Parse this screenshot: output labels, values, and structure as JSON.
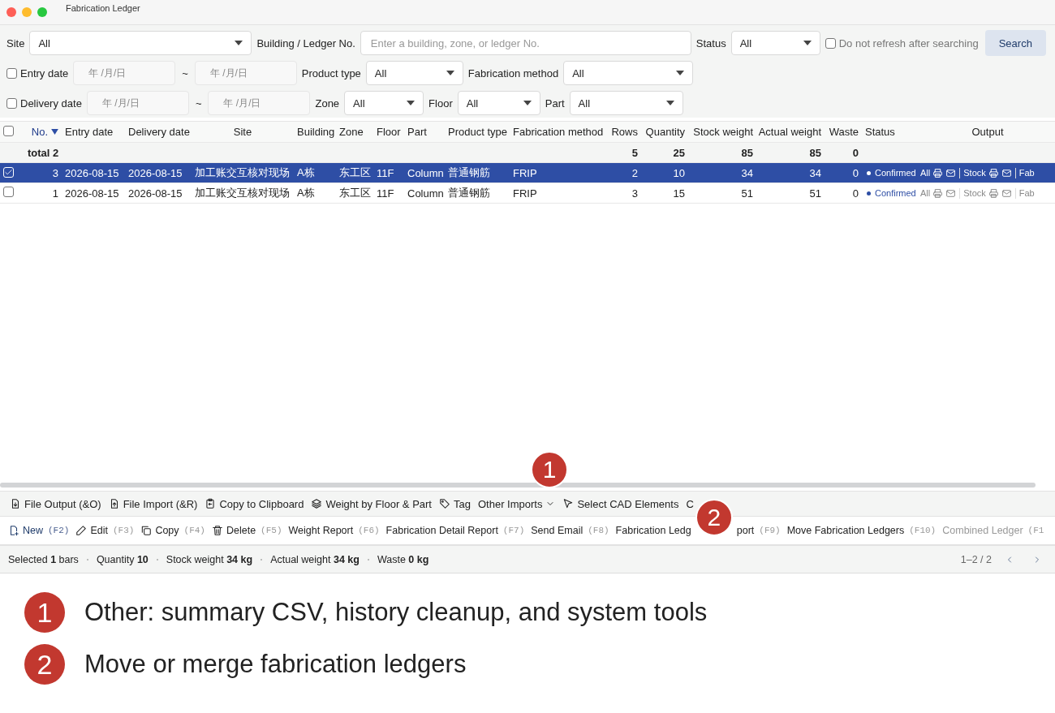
{
  "window": {
    "title": "Fabrication Ledger"
  },
  "filters": [
    [
      {
        "kind": "select",
        "label": "Site",
        "value": "All"
      },
      {
        "kind": "text",
        "label": "Building / Ledger No.",
        "placeholder": "Enter a building, zone, or ledger No."
      },
      {
        "kind": "select",
        "label": "Status",
        "value": "All"
      },
      {
        "kind": "checkbox",
        "label": "Do not refresh after searching",
        "checked": false
      },
      {
        "kind": "button",
        "label": "Search"
      }
    ],
    [
      {
        "kind": "date_range",
        "label": "Entry date",
        "checked": false,
        "from": "年 /月/日",
        "separator": "~",
        "to": "年 /月/日"
      },
      {
        "kind": "select",
        "label": "Product type",
        "value": "All"
      },
      {
        "kind": "select",
        "label": "Fabrication method",
        "value": "All"
      }
    ],
    [
      {
        "kind": "date_range",
        "label": "Delivery date",
        "checked": false,
        "from": "年 /月/日",
        "separator": "~",
        "to": "年 /月/日"
      },
      {
        "kind": "select",
        "label": "Zone",
        "value": "All"
      },
      {
        "kind": "select",
        "label": "Floor",
        "value": "All"
      },
      {
        "kind": "select",
        "label": "Part",
        "value": "All"
      }
    ]
  ],
  "table": {
    "all_checked": false,
    "columns": [
      {
        "label": "No.",
        "sorted": true
      },
      {
        "label": "Entry date",
        "sorted": false
      },
      {
        "label": "Delivery date",
        "sorted": false
      },
      {
        "label": "Site",
        "sorted": false
      },
      {
        "label": "Building",
        "sorted": false
      },
      {
        "label": "Zone",
        "sorted": false
      },
      {
        "label": "Floor",
        "sorted": false
      },
      {
        "label": "Part",
        "sorted": false
      },
      {
        "label": "Product type",
        "sorted": false
      },
      {
        "label": "Fabrication method",
        "sorted": false
      },
      {
        "label": "Rows",
        "sorted": false
      },
      {
        "label": "Quantity",
        "sorted": false
      },
      {
        "label": "Stock weight",
        "sorted": false
      },
      {
        "label": "Actual weight",
        "sorted": false
      },
      {
        "label": "Waste",
        "sorted": false
      },
      {
        "label": "Status",
        "sorted": false
      },
      {
        "label": "Output",
        "sorted": false
      }
    ],
    "total": {
      "label": "total 2",
      "rows": "5",
      "quantity": "25",
      "stock_weight": "85",
      "actual_weight": "85",
      "waste": "0"
    },
    "rows": [
      {
        "selected": true,
        "checked": true,
        "cells": [
          "3",
          "2026-08-15",
          "2026-08-15",
          "加工账交互核对现场",
          "A栋",
          "东工区",
          "11F",
          "Column",
          "普通钢筋",
          "FRIP",
          "2",
          "10",
          "34",
          "34",
          "0"
        ],
        "status": "Confirmed",
        "output": [
          {
            "label": "All",
            "icons": true
          },
          {
            "label": "Stock",
            "icons": true
          },
          {
            "label": "Fab",
            "icons": false
          }
        ]
      },
      {
        "selected": false,
        "checked": false,
        "cells": [
          "1",
          "2026-08-15",
          "2026-08-15",
          "加工账交互核对现场",
          "A栋",
          "东工区",
          "11F",
          "Column",
          "普通钢筋",
          "FRIP",
          "3",
          "15",
          "51",
          "51",
          "0"
        ],
        "status": "Confirmed",
        "output": [
          {
            "label": "All",
            "icons": true
          },
          {
            "label": "Stock",
            "icons": true
          },
          {
            "label": "Fab",
            "icons": false
          }
        ]
      }
    ]
  },
  "toolbar": [
    {
      "label": "File Output (&O)",
      "dropdown": false
    },
    {
      "label": "File Import (&R)",
      "dropdown": false
    },
    {
      "label": "Copy to Clipboard",
      "dropdown": false
    },
    {
      "label": "Weight by Floor & Part",
      "dropdown": false
    },
    {
      "label": "Tag",
      "dropdown": false
    },
    {
      "label": "Other Imports",
      "dropdown": true
    },
    {
      "label": "Select CAD Elements",
      "dropdown": false
    },
    {
      "label": "C",
      "dropdown": false
    }
  ],
  "actions": [
    {
      "label": "New",
      "shortcut": "(F2)",
      "primary": true,
      "disabled": false
    },
    {
      "label": "Edit",
      "shortcut": "(F3)",
      "primary": false,
      "disabled": false
    },
    {
      "label": "Copy",
      "shortcut": "(F4)",
      "primary": false,
      "disabled": false
    },
    {
      "label": "Delete",
      "shortcut": "(F5)",
      "primary": false,
      "disabled": false
    },
    {
      "label": "Weight Report",
      "shortcut": "(F6)",
      "primary": false,
      "disabled": false
    },
    {
      "label": "Fabrication Detail Report",
      "shortcut": "(F7)",
      "primary": false,
      "disabled": false
    },
    {
      "label": "Send Email",
      "shortcut": "(F8)",
      "primary": false,
      "disabled": false
    },
    {
      "label": "Fabrication Ledg",
      "label_after": "port",
      "shortcut": "(F9)",
      "primary": false,
      "disabled": false
    },
    {
      "label": "Move Fabrication Ledgers",
      "shortcut": "(F10)",
      "primary": false,
      "disabled": false
    },
    {
      "label": "Combined Ledger",
      "shortcut": "(F1",
      "primary": false,
      "disabled": true
    }
  ],
  "status_bar": {
    "items": [
      "Selected **1** bars",
      "Quantity **10**",
      "Stock weight **34 kg**",
      "Actual weight **34 kg**",
      "Waste **0 kg**"
    ],
    "pagination": "1–2 / 2"
  },
  "markers": [
    {
      "number": "1"
    },
    {
      "number": "2"
    }
  ],
  "callouts": [
    {
      "number": "1",
      "text": "Other: summary CSV, history cleanup, and system tools"
    },
    {
      "number": "2",
      "text": "Move or merge fabrication ledgers"
    }
  ]
}
